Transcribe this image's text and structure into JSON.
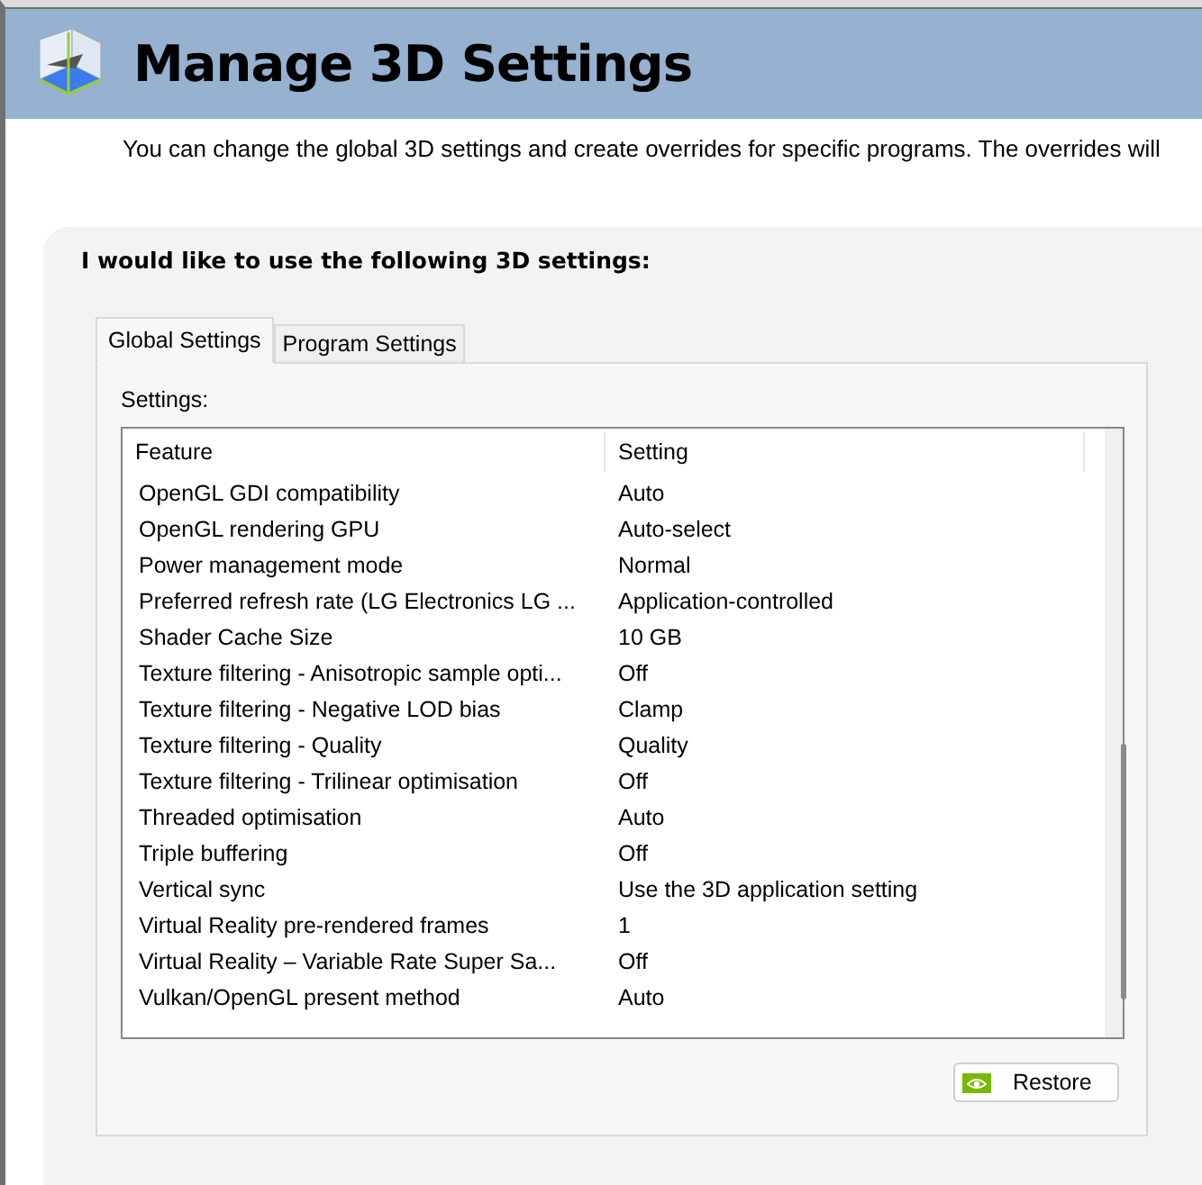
{
  "header": {
    "title": "Manage 3D Settings"
  },
  "description": "You can change the global 3D settings and create overrides for specific programs. The overrides will",
  "panel": {
    "heading": "I would like to use the following 3D settings:"
  },
  "tabs": [
    {
      "label": "Global Settings",
      "selected": true
    },
    {
      "label": "Program Settings",
      "selected": false
    }
  ],
  "settings_label": "Settings:",
  "table": {
    "columns": [
      "Feature",
      "Setting"
    ],
    "rows": [
      {
        "feature": "OpenGL GDI compatibility",
        "setting": "Auto"
      },
      {
        "feature": "OpenGL rendering GPU",
        "setting": "Auto-select"
      },
      {
        "feature": "Power management mode",
        "setting": "Normal"
      },
      {
        "feature": "Preferred refresh rate (LG Electronics LG ...",
        "setting": "Application-controlled"
      },
      {
        "feature": "Shader Cache Size",
        "setting": "10 GB"
      },
      {
        "feature": "Texture filtering - Anisotropic sample opti...",
        "setting": "Off"
      },
      {
        "feature": "Texture filtering - Negative LOD bias",
        "setting": "Clamp"
      },
      {
        "feature": "Texture filtering - Quality",
        "setting": "Quality"
      },
      {
        "feature": "Texture filtering - Trilinear optimisation",
        "setting": "Off"
      },
      {
        "feature": "Threaded optimisation",
        "setting": "Auto"
      },
      {
        "feature": "Triple buffering",
        "setting": "Off"
      },
      {
        "feature": "Vertical sync",
        "setting": "Use the 3D application setting"
      },
      {
        "feature": "Virtual Reality pre-rendered frames",
        "setting": "1"
      },
      {
        "feature": "Virtual Reality – Variable Rate Super Sa...",
        "setting": "Off"
      },
      {
        "feature": "Vulkan/OpenGL present method",
        "setting": "Auto"
      }
    ]
  },
  "buttons": [
    {
      "label": "Restore"
    }
  ]
}
